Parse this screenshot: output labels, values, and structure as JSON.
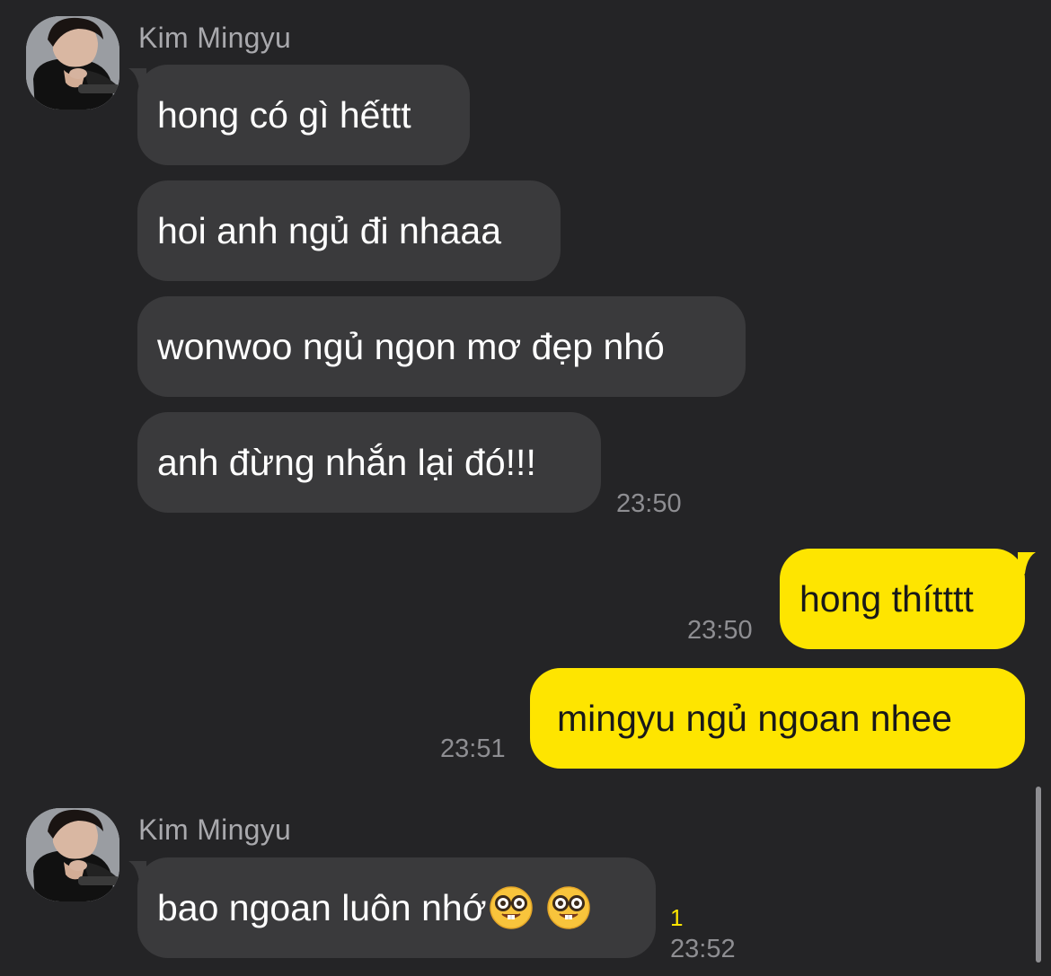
{
  "colors": {
    "background": "#242426",
    "incoming_bubble": "#3a3a3c",
    "outgoing_bubble": "#fee500",
    "timestamp": "#8e8e92",
    "unread_count": "#fee500"
  },
  "groups": [
    {
      "sender": "Kim Mingyu",
      "messages": [
        "hong có gì hếttt",
        "hoi anh ngủ đi nhaaa",
        "wonwoo ngủ ngon mơ đẹp nhó",
        "anh đừng nhắn lại đó!!!"
      ],
      "time": "23:50"
    },
    {
      "sender": "",
      "messages": [
        {
          "text": "hong thítttt",
          "time": "23:50"
        },
        {
          "text": "mingyu ngủ ngoan nhee",
          "time": "23:51"
        }
      ]
    },
    {
      "sender": "Kim Mingyu",
      "messages": [
        {
          "text": "bao ngoan luôn nhớ",
          "emojis": [
            "nerd-face-icon",
            "nerd-face-icon"
          ]
        }
      ],
      "unread": "1",
      "time": "23:52"
    }
  ]
}
